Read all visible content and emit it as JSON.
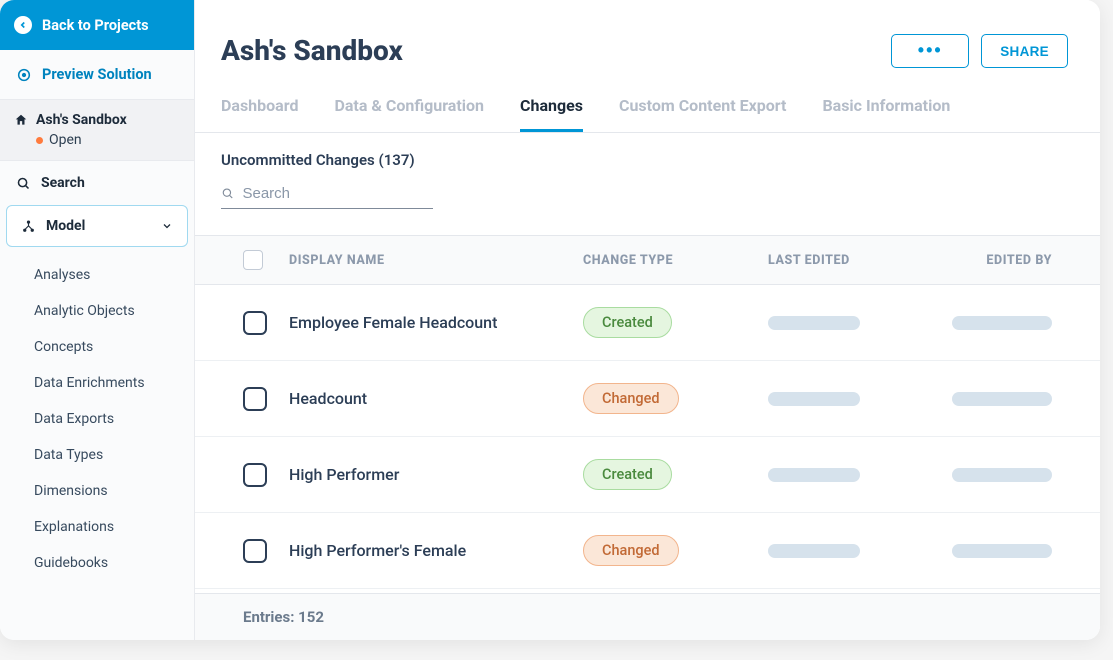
{
  "sidebar": {
    "back_label": "Back to Projects",
    "preview_label": "Preview Solution",
    "project_name": "Ash's Sandbox",
    "project_status": "Open",
    "search_label": "Search",
    "model_label": "Model",
    "model_children": [
      "Analyses",
      "Analytic Objects",
      "Concepts",
      "Data Enrichments",
      "Data Exports",
      "Data Types",
      "Dimensions",
      "Explanations",
      "Guidebooks"
    ]
  },
  "header": {
    "title": "Ash's Sandbox",
    "more_label": "•••",
    "share_label": "SHARE"
  },
  "tabs": [
    {
      "label": "Dashboard",
      "active": false
    },
    {
      "label": "Data & Configuration",
      "active": false
    },
    {
      "label": "Changes",
      "active": true
    },
    {
      "label": "Custom Content Export",
      "active": false
    },
    {
      "label": "Basic Information",
      "active": false
    }
  ],
  "changes": {
    "uncommitted_label": "Uncommitted Changes (137)",
    "search_placeholder": "Search",
    "columns": {
      "name": "DISPLAY NAME",
      "type": "CHANGE TYPE",
      "last": "LAST EDITED",
      "by": "EDITED BY"
    },
    "rows": [
      {
        "name": "Employee Female Headcount",
        "type": "Created"
      },
      {
        "name": "Headcount",
        "type": "Changed"
      },
      {
        "name": "High Performer",
        "type": "Created"
      },
      {
        "name": "High Performer's Female",
        "type": "Changed"
      }
    ],
    "entries_label": "Entries: 152"
  }
}
